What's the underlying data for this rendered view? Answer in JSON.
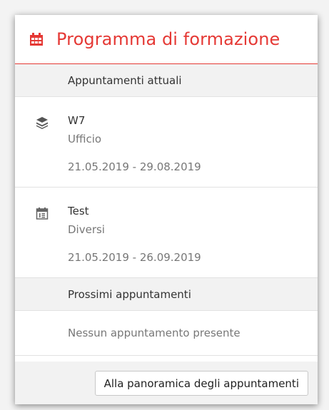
{
  "widget": {
    "title": "Programma di formazione",
    "accent_color": "#e53935",
    "header_icon": "calendar-icon"
  },
  "current": {
    "heading": "Appuntamenti attuali",
    "items": [
      {
        "name": "W7",
        "category": "Ufficio",
        "dates": "21.05.2019 - 29.08.2019",
        "icon": "layers-icon"
      },
      {
        "name": "Test",
        "category": "Diversi",
        "dates": "21.05.2019 - 26.09.2019",
        "icon": "calendar-day-icon"
      }
    ]
  },
  "upcoming": {
    "heading": "Prossimi appuntamenti",
    "empty_text": "Nessun appuntamento presente"
  },
  "footer": {
    "button_label": "Alla panoramica degli appuntamenti"
  }
}
